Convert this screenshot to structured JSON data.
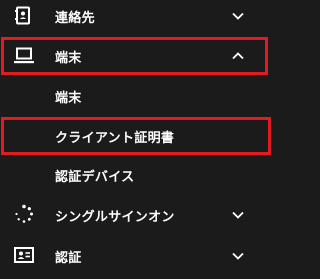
{
  "accent_color": "#e11b22",
  "menu": {
    "contacts": {
      "label": "連絡先",
      "icon": "contact-book-icon",
      "chevron": "chevron-down-icon"
    },
    "devices": {
      "label": "端末",
      "icon": "laptop-icon",
      "chevron": "chevron-up-icon",
      "expanded": true
    },
    "devices_sub": [
      {
        "label": "端末"
      },
      {
        "label": "クライアント証明書"
      },
      {
        "label": "認証デバイス"
      }
    ],
    "sso": {
      "label": "シングルサインオン",
      "icon": "loading-spinner-icon",
      "chevron": "chevron-down-icon"
    },
    "auth": {
      "label": "認証",
      "icon": "id-card-icon",
      "chevron": "chevron-down-icon"
    }
  }
}
